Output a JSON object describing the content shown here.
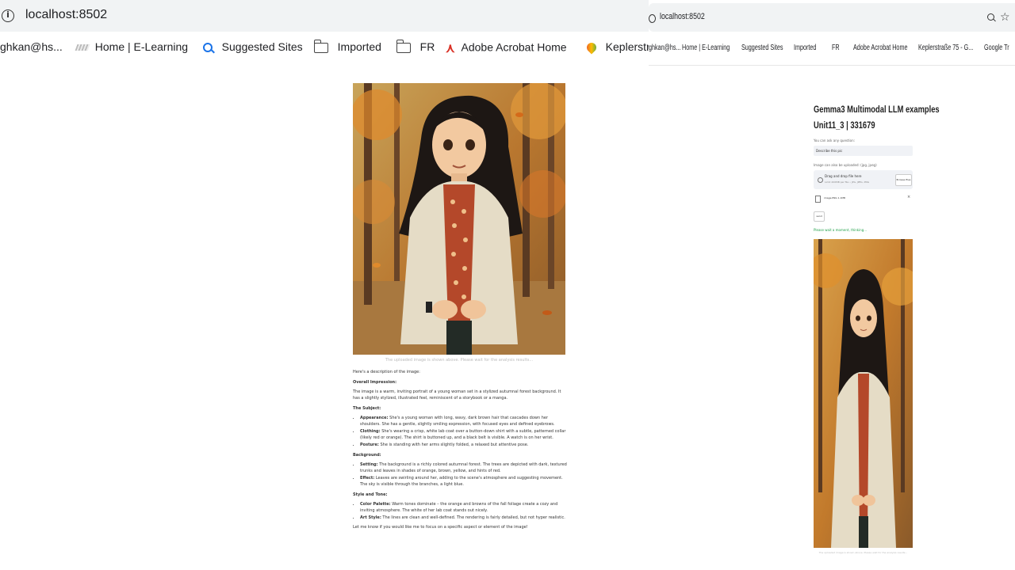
{
  "left_browser": {
    "url": "localhost:8502",
    "bookmarks": [
      {
        "label": "ghkan@hs...",
        "icon": "none"
      },
      {
        "label": "Home | E-Learning",
        "icon": "elearning-icon"
      },
      {
        "label": "Suggested Sites",
        "icon": "search-icon"
      },
      {
        "label": "Imported",
        "icon": "folder-icon"
      },
      {
        "label": "FR",
        "icon": "folder-icon"
      },
      {
        "label": "Adobe Acrobat Home",
        "icon": "adobe-acrobat-icon"
      },
      {
        "label": "Keplerstr",
        "icon": "maps-pin-icon"
      }
    ]
  },
  "main": {
    "image_caption": "The uploaded image is shown above. Please wait for the analysis results...",
    "description": {
      "intro": "Here's a description of the image:",
      "overall_heading": "Overall Impression:",
      "overall_text": "The image is a warm, inviting portrait of a young woman set in a stylized autumnal forest background. It has a slightly stylized, illustrated feel, reminiscent of a storybook or a manga.",
      "subject_heading": "The Subject:",
      "subject_items": [
        {
          "label": "Appearance:",
          "text": "She's a young woman with long, wavy, dark brown hair that cascades down her shoulders. She has a gentle, slightly smiling expression, with focused eyes and defined eyebrows."
        },
        {
          "label": "Clothing:",
          "text": "She's wearing a crisp, white lab coat over a button-down shirt with a subtle, patterned collar (likely red or orange). The shirt is buttoned up, and a black belt is visible. A watch is on her wrist."
        },
        {
          "label": "Posture:",
          "text": "She is standing with her arms slightly folded, a relaxed but attentive pose."
        }
      ],
      "background_heading": "Background:",
      "background_items": [
        {
          "label": "Setting:",
          "text": "The background is a richly colored autumnal forest. The trees are depicted with dark, textured trunks and leaves in shades of orange, brown, yellow, and hints of red."
        },
        {
          "label": "Effect:",
          "text": "Leaves are swirling around her, adding to the scene's atmosphere and suggesting movement. The sky is visible through the branches, a light blue."
        }
      ],
      "style_heading": "Style and Tone:",
      "style_items": [
        {
          "label": "Color Palette:",
          "text": "Warm tones dominate – the orange and browns of the fall foliage create a cozy and inviting atmosphere. The white of her lab coat stands out nicely."
        },
        {
          "label": "Art Style:",
          "text": "The lines are clean and well-defined. The rendering is fairly detailed, but not hyper realistic."
        }
      ],
      "closing": "Let me know if you would like me to focus on a specific aspect or element of the image!"
    }
  },
  "right_browser": {
    "url": "localhost:8502",
    "bookmarks": [
      "ghkan@hs...",
      "Home | E-Learning",
      "Suggested Sites",
      "Imported",
      "FR",
      "Adobe Acrobat Home",
      "Keplerstraße 75 - G...",
      "Google Tr"
    ],
    "title_line1": "Gemma3 Multimodal LLM examples",
    "title_line2": "Unit11_3 | 331679",
    "question_label": "You can ask any question:",
    "question_value": "Describe this pic",
    "upload_label": "Image can also be uploaded: (jpg, jpeg)",
    "drop_text": "Drag and drop file here",
    "drop_limit": "Limit 200MB per file • JPG, JPEG, PNG",
    "browse_label": "Browse files",
    "file_name": "image.PNG 1.1MB",
    "send_label": "send",
    "status_text": "Please wait a moment, thinking...",
    "image_caption": "The uploaded image is shown above. Please wait for the analysis results..."
  },
  "colors": {
    "accent_green": "#21a04a",
    "tab_bar": "#f1f3f4"
  }
}
